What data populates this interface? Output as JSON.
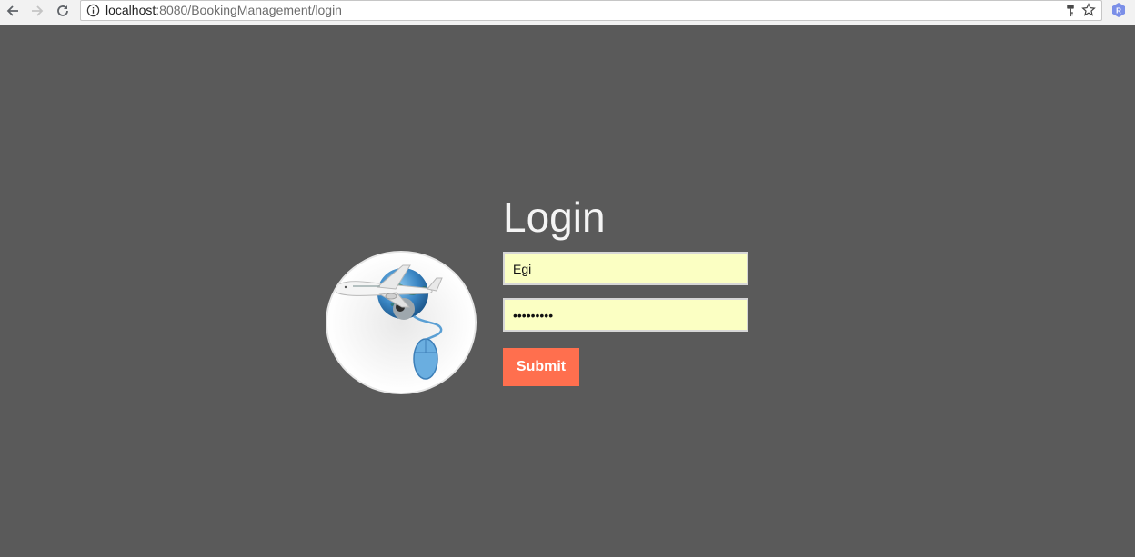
{
  "browser": {
    "url_host": "localhost",
    "url_path": ":8080/BookingManagement/login",
    "extension_letter": "R",
    "icons": [
      "back-arrow-icon",
      "forward-arrow-icon",
      "reload-icon",
      "info-icon",
      "key-icon",
      "star-icon",
      "extension-icon"
    ]
  },
  "login": {
    "title": "Login",
    "username_value": "Egi",
    "password_value": "•••••••••",
    "submit_label": "Submit"
  },
  "colors": {
    "page_background": "#5a5a5a",
    "input_background": "#fbffc3",
    "submit_background": "#ff6f4e",
    "title_color": "#f4f4f4"
  }
}
